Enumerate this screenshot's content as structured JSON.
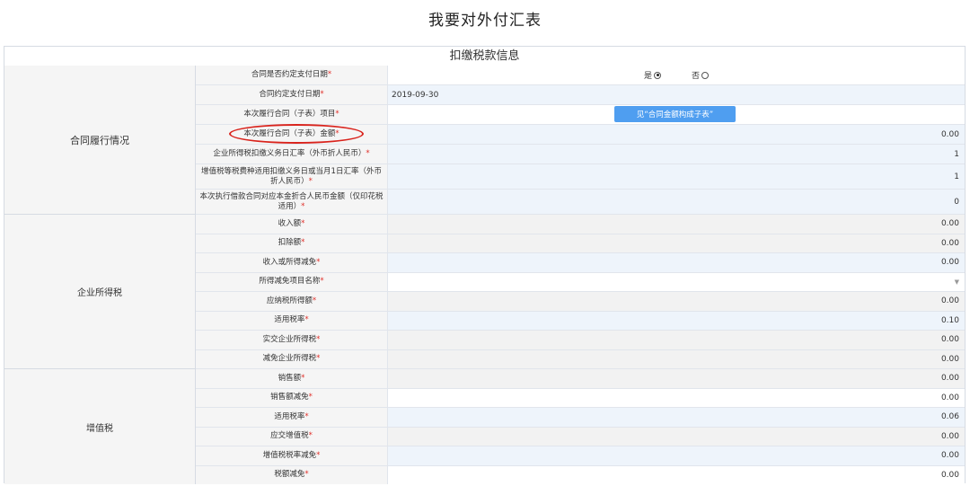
{
  "page": {
    "title": "我要对外付汇表"
  },
  "section": {
    "title": "扣缴税款信息"
  },
  "groups": {
    "contract": "合同履行情况",
    "income_tax": "企业所得税",
    "vat": "增值税"
  },
  "contract_rows": [
    {
      "label": "合同是否约定支付日期",
      "type": "radio"
    },
    {
      "label": "合同约定支付日期",
      "value": "2019-09-30"
    },
    {
      "label": "本次履行合同（子表）项目",
      "type": "button"
    },
    {
      "label": "本次履行合同（子表）金额",
      "value": "0.00"
    },
    {
      "label": "企业所得税扣缴义务日汇率（外币折人民币）",
      "value": "1"
    },
    {
      "label": "增值税等税费种适用扣缴义务日或当月1日汇率（外币折人民币）",
      "value": "1"
    },
    {
      "label": "本次执行借款合同对应本金折合人民币金额（仅印花税适用）",
      "value": "0"
    }
  ],
  "radio": {
    "yes": "是",
    "no": "否",
    "selected": "yes"
  },
  "button": {
    "label": "见“合同金额构成子表”"
  },
  "income_tax_rows": [
    {
      "label": "收入额",
      "value": "0.00"
    },
    {
      "label": "扣除额",
      "value": "0.00"
    },
    {
      "label": "收入或所得减免",
      "value": "0.00"
    },
    {
      "label": "所得减免项目名称",
      "value": ""
    },
    {
      "label": "应纳税所得额",
      "value": "0.00"
    },
    {
      "label": "适用税率",
      "value": "0.10"
    },
    {
      "label": "实交企业所得税",
      "value": "0.00"
    },
    {
      "label": "减免企业所得税",
      "value": "0.00"
    }
  ],
  "vat_rows": [
    {
      "label": "销售额",
      "value": "0.00"
    },
    {
      "label": "销售额减免",
      "value": "0.00"
    },
    {
      "label": "适用税率",
      "value": "0.06"
    },
    {
      "label": "应交增值税",
      "value": "0.00"
    },
    {
      "label": "增值税税率减免",
      "value": "0.00"
    },
    {
      "label": "税额减免",
      "value": "0.00"
    }
  ],
  "required_mark": "*",
  "colors": {
    "required": "#e0302a",
    "button": "#4f9ef0",
    "highlight_ellipse": "#d9231c"
  }
}
